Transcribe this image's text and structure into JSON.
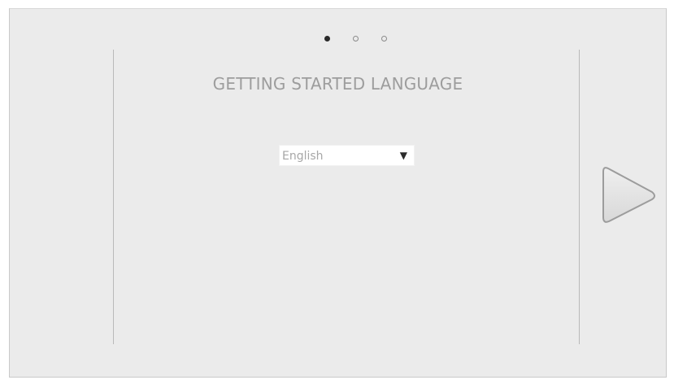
{
  "pager": {
    "pages": 3,
    "current": 1
  },
  "title": "GETTING STARTED LANGUAGE",
  "language_select": {
    "selected": "English",
    "arrow_glyph": "▼"
  },
  "next_button": {
    "icon": "play-triangle-icon",
    "fill": "#e2e2e2",
    "stroke": "#9c9c9c"
  },
  "colors": {
    "background": "#ebebeb",
    "title_text": "#9d9d9d",
    "rule": "#b9b9b9"
  }
}
